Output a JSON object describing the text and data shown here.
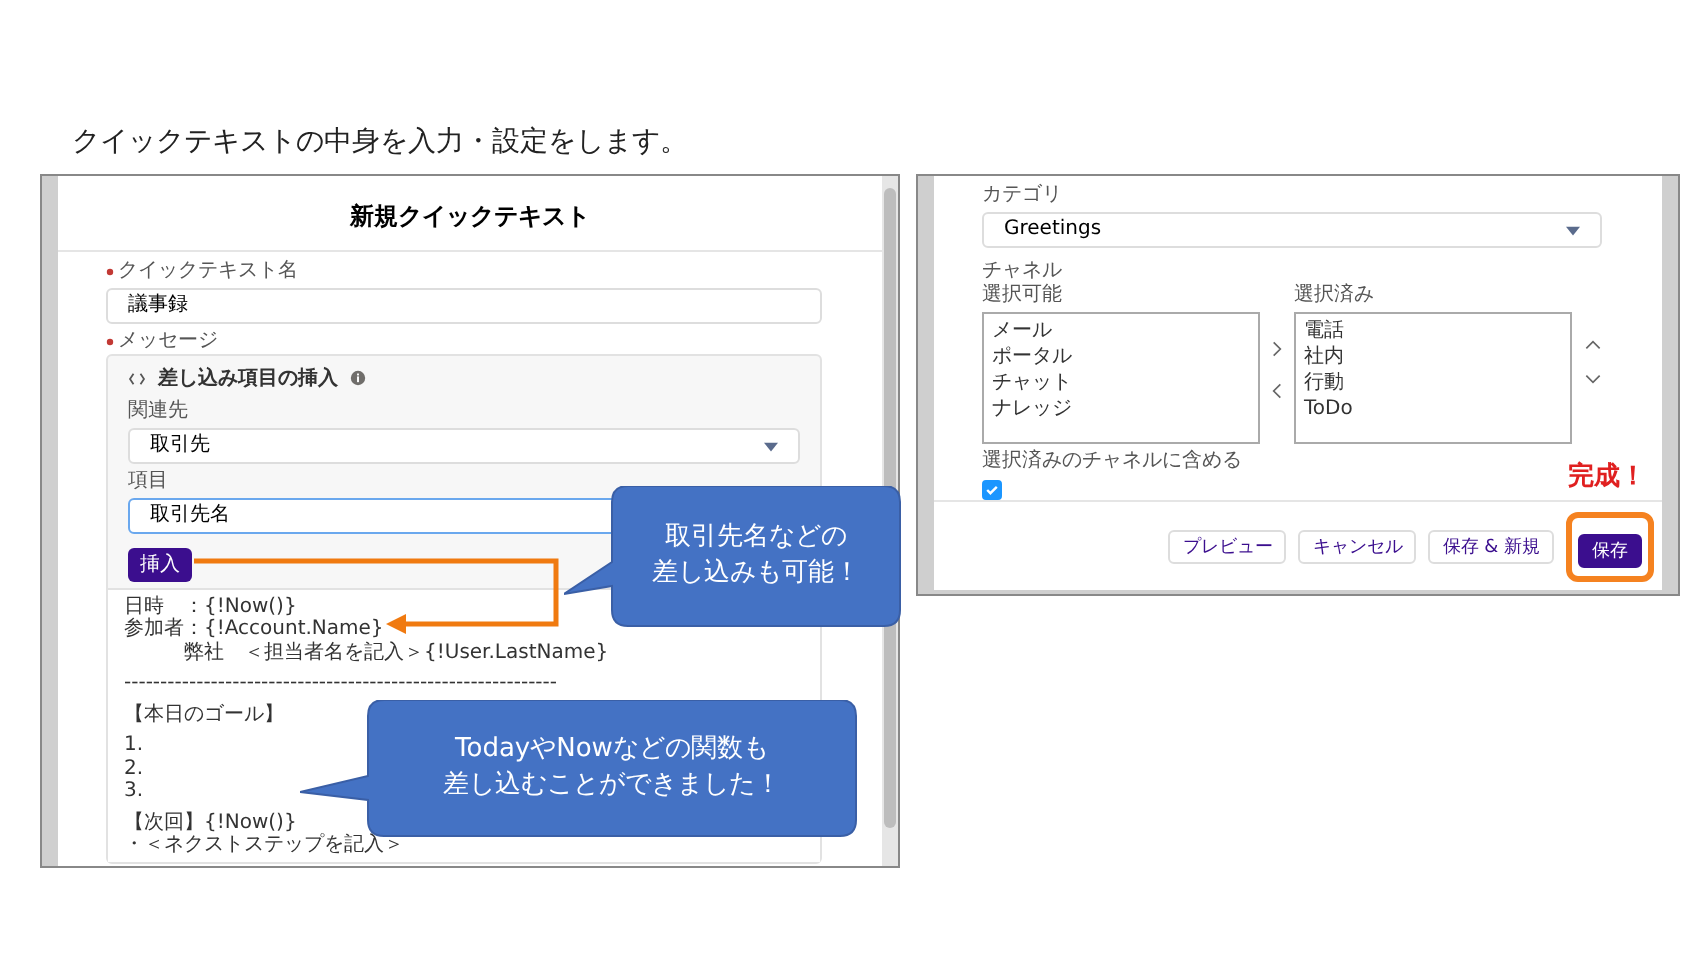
{
  "heading": "クイックテキストの中身を入力・設定をします。",
  "quick_text_dialog": {
    "title": "新規クイックテキスト",
    "name_field": {
      "label": "クイックテキスト名",
      "required": true,
      "value": "議事録"
    },
    "message": {
      "label": "メッセージ",
      "required": true
    },
    "merge_panel": {
      "title": "差し込み項目の挿入",
      "related_label": "関連先",
      "related_value": "取引先",
      "field_label": "項目",
      "field_value": "取引先名",
      "insert_button": "挿入"
    },
    "body_paragraphs": [
      [
        "日時　：{!Now()}",
        "参加者：{!Account.Name}",
        "　　　弊社　＜担当者名を記入＞{!User.LastName}"
      ],
      [
        "------------------------------------------------------------"
      ],
      [
        "【本日のゴール】"
      ],
      [
        "1.",
        "2.",
        "3."
      ],
      [
        "【次回】{!Now()}",
        "・＜ネクストステップを記入＞"
      ]
    ]
  },
  "callouts": [
    {
      "lines": [
        "取引先名などの",
        "差し込みも可能！"
      ]
    },
    {
      "lines": [
        "TodayやNowなどの関数も",
        "差し込むことができました！"
      ]
    }
  ],
  "channel_settings": {
    "category": {
      "label": "カテゴリ",
      "value": "Greetings"
    },
    "channels_label": "チャネル",
    "available": {
      "label": "選択可能",
      "items": [
        "メール",
        "ポータル",
        "チャット",
        "ナレッジ"
      ]
    },
    "chosen": {
      "label": "選択済み",
      "items": [
        "電話",
        "社内",
        "行動",
        "ToDo"
      ]
    },
    "include_checkbox": {
      "label": "選択済みのチャネルに含める",
      "checked": true
    },
    "footer_buttons": [
      {
        "label": "プレビュー",
        "kind": "neutral"
      },
      {
        "label": "キャンセル",
        "kind": "neutral"
      },
      {
        "label": "保存 & 新規",
        "kind": "neutral"
      },
      {
        "label": "保存",
        "kind": "brand",
        "highlighted": true
      }
    ],
    "highlight_note": "完成！"
  }
}
